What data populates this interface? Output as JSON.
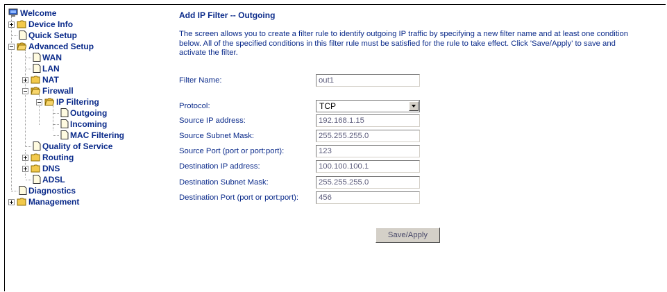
{
  "tree": {
    "welcome": "Welcome",
    "device_info": "Device Info",
    "quick_setup": "Quick Setup",
    "advanced_setup": "Advanced Setup",
    "wan": "WAN",
    "lan": "LAN",
    "nat": "NAT",
    "firewall": "Firewall",
    "ip_filtering": "IP Filtering",
    "outgoing": "Outgoing",
    "incoming": "Incoming",
    "mac_filtering": "MAC Filtering",
    "qos": "Quality of Service",
    "routing": "Routing",
    "dns": "DNS",
    "adsl": "ADSL",
    "diagnostics": "Diagnostics",
    "management": "Management"
  },
  "page": {
    "title": "Add IP Filter -- Outgoing",
    "description": "The screen allows you to create a filter rule to identify outgoing IP traffic by specifying a new filter name and at least one condition below. All of the specified conditions in this filter rule must be satisfied for the rule to take effect. Click 'Save/Apply' to save and activate the filter."
  },
  "form": {
    "filter_name_label": "Filter Name:",
    "filter_name_value": "out1",
    "protocol_label": "Protocol:",
    "protocol_value": "TCP",
    "src_ip_label": "Source IP address:",
    "src_ip_value": "192.168.1.15",
    "src_mask_label": "Source Subnet Mask:",
    "src_mask_value": "255.255.255.0",
    "src_port_label": "Source Port (port or port:port):",
    "src_port_value": "123",
    "dst_ip_label": "Destination IP address:",
    "dst_ip_value": "100.100.100.1",
    "dst_mask_label": "Destination Subnet Mask:",
    "dst_mask_value": "255.255.255.0",
    "dst_port_label": "Destination Port (port or port:port):",
    "dst_port_value": "456",
    "save_label": "Save/Apply"
  },
  "colors": {
    "link_text": "#0a2a8a",
    "folder": "#f2c94c"
  }
}
